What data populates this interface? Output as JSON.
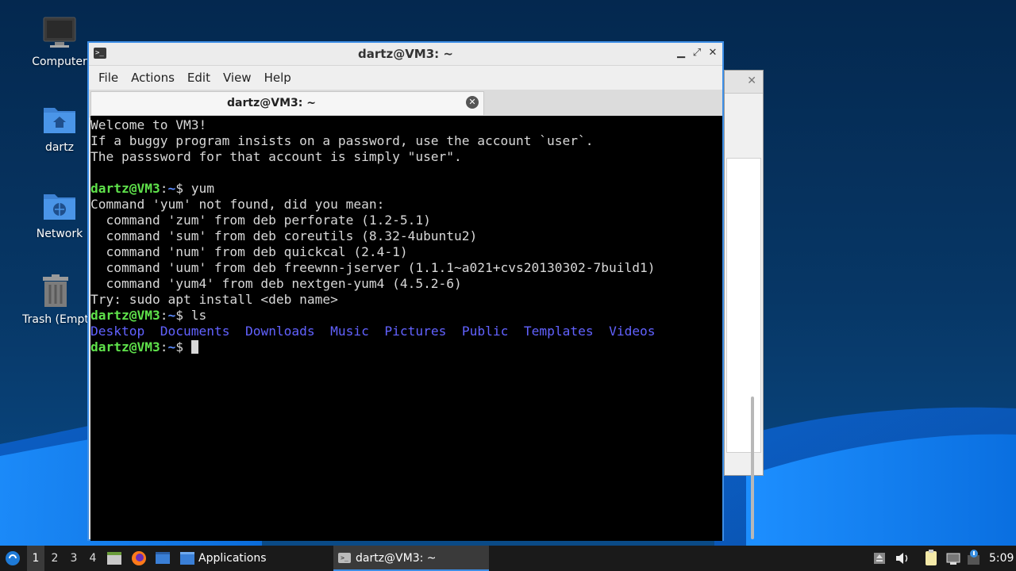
{
  "desktop": {
    "icons": [
      {
        "label": "Computer",
        "icon": "computer-icon"
      },
      {
        "label": "dartz",
        "icon": "home-folder-icon"
      },
      {
        "label": "Network",
        "icon": "network-folder-icon"
      },
      {
        "label": "Trash (Empt",
        "icon": "trash-icon"
      }
    ]
  },
  "terminal_window": {
    "title": "dartz@VM3: ~",
    "menu": [
      "File",
      "Actions",
      "Edit",
      "View",
      "Help"
    ],
    "tab_label": "dartz@VM3: ~",
    "lines": {
      "l1": "Welcome to VM3!",
      "l2": "If a buggy program insists on a password, use the account `user`.",
      "l3": "The passsword for that account is simply \"user\".",
      "l5_cmd": " yum",
      "l6": "Command 'yum' not found, did you mean:",
      "l7": "  command 'zum' from deb perforate (1.2-5.1)",
      "l8": "  command 'sum' from deb coreutils (8.32-4ubuntu2)",
      "l9": "  command 'num' from deb quickcal (2.4-1)",
      "l10": "  command 'uum' from deb freewnn-jserver (1.1.1~a021+cvs20130302-7build1)",
      "l11": "  command 'yum4' from deb nextgen-yum4 (4.5.2-6)",
      "l12": "Try: sudo apt install <deb name>",
      "l13_cmd": " ls",
      "ls_output": [
        "Desktop",
        "Documents",
        "Downloads",
        "Music",
        "Pictures",
        "Public",
        "Templates",
        "Videos"
      ]
    },
    "prompt": {
      "user": "dartz@VM3",
      "sep": ":",
      "path": "~",
      "symbol": "$"
    }
  },
  "taskbar": {
    "workspaces": [
      "1",
      "2",
      "3",
      "4"
    ],
    "active_workspace": "1",
    "applications_label": "Applications",
    "task_label": "dartz@VM3: ~",
    "clock": "5:09"
  },
  "colors": {
    "prompt_user": "#5fe24b",
    "prompt_path": "#5c8cff",
    "directory": "#6262ff",
    "window_border": "#3d8ee6"
  }
}
